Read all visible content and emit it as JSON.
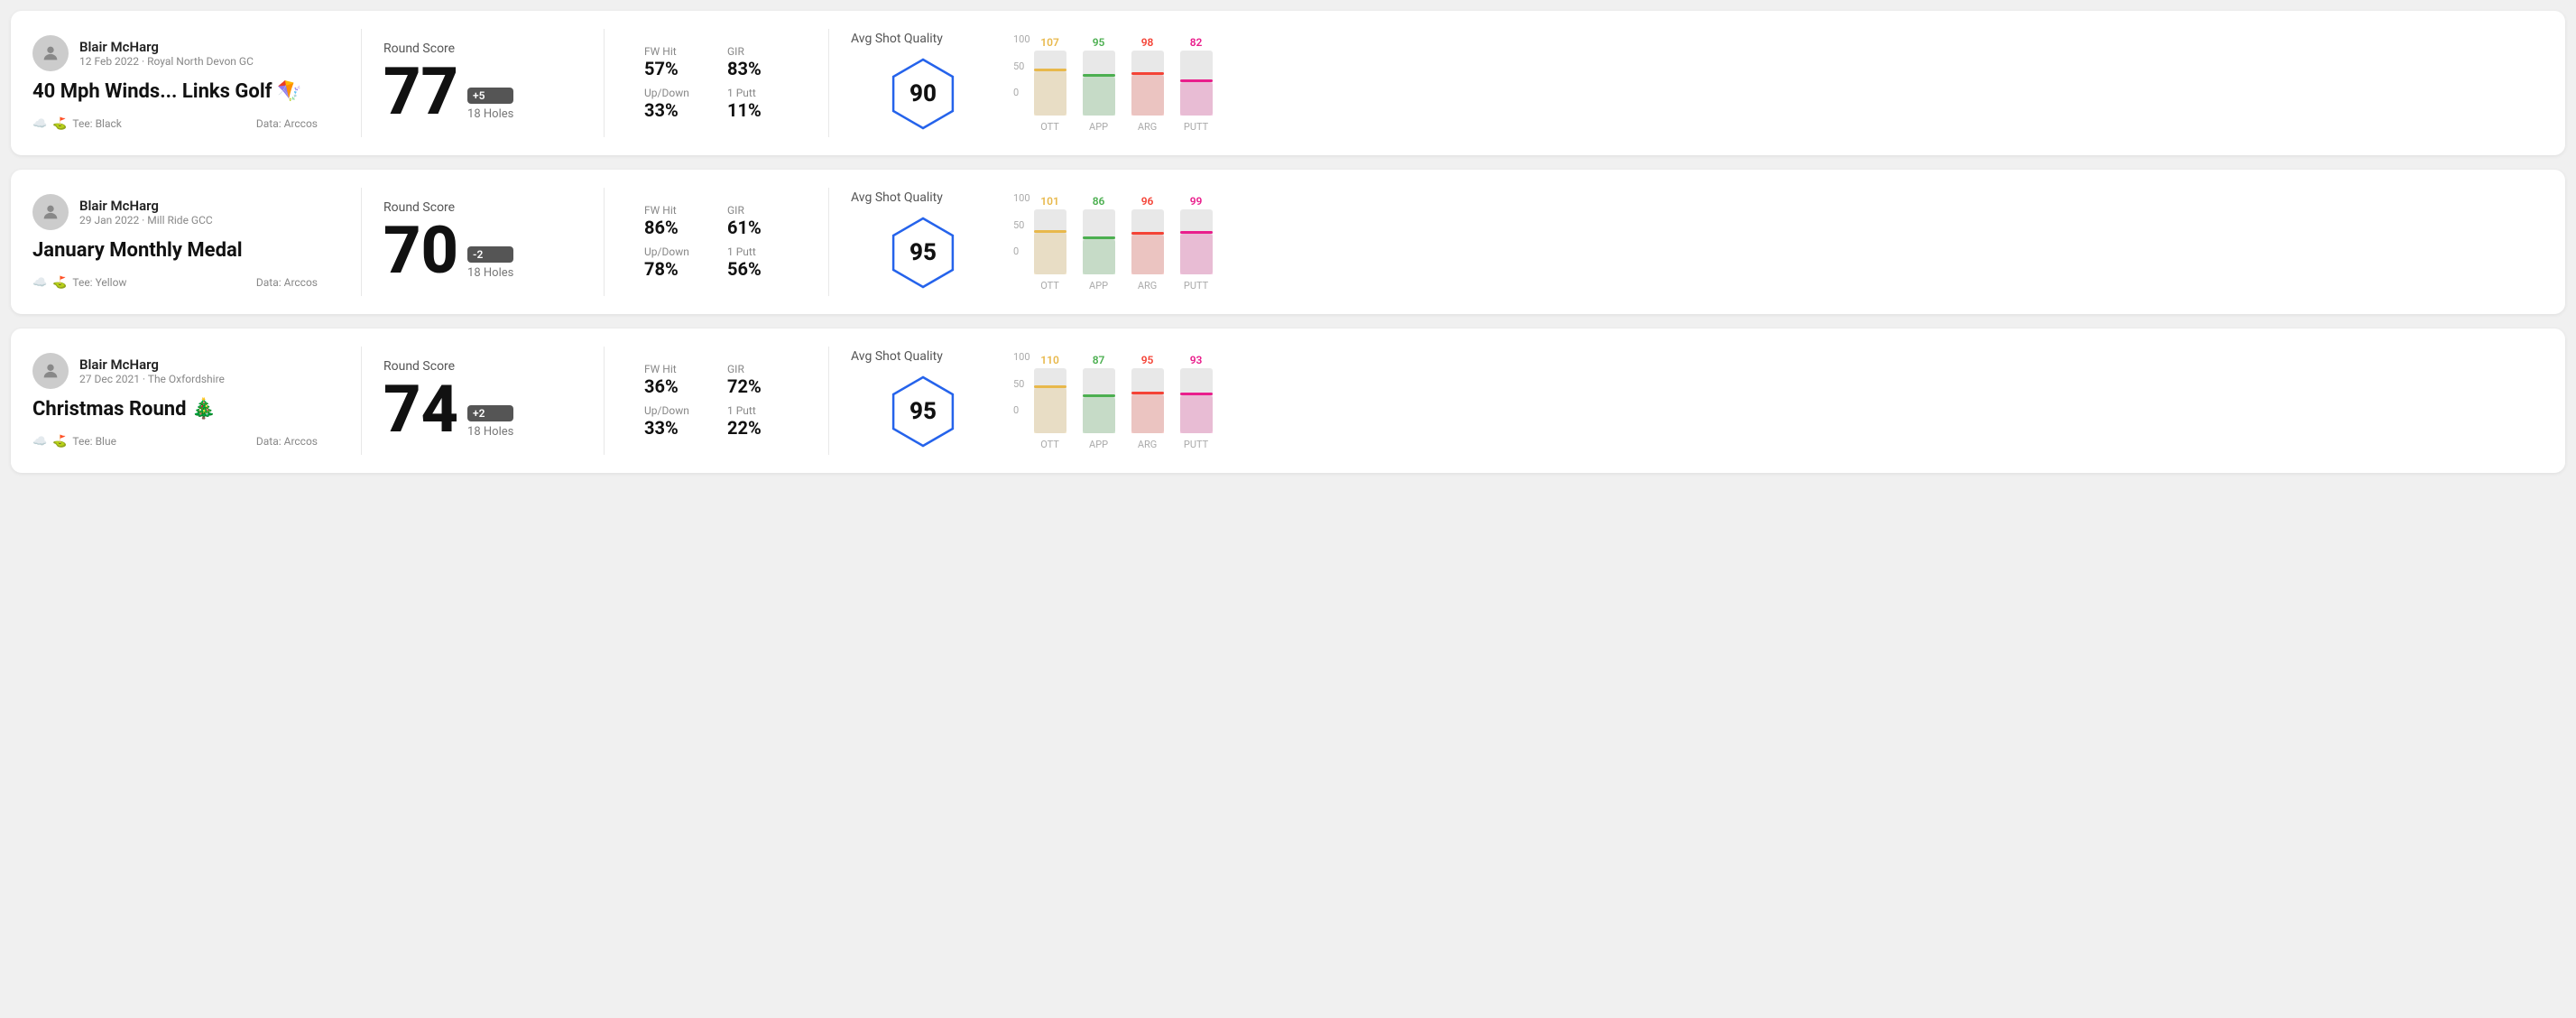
{
  "cards": [
    {
      "id": "card1",
      "user": {
        "name": "Blair McHarg",
        "meta": "12 Feb 2022 · Royal North Devon GC"
      },
      "title": "40 Mph Winds... Links Golf 🪁",
      "tee": "Black",
      "data_source": "Data: Arccos",
      "round_score_label": "Round Score",
      "score": "77",
      "badge": "+5",
      "holes": "18 Holes",
      "stats": [
        {
          "label": "FW Hit",
          "value": "57%"
        },
        {
          "label": "GIR",
          "value": "83%"
        },
        {
          "label": "Up/Down",
          "value": "33%"
        },
        {
          "label": "1 Putt",
          "value": "11%"
        }
      ],
      "quality_label": "Avg Shot Quality",
      "quality_score": "90",
      "chart": [
        {
          "label": "OTT",
          "value": 107,
          "color": "#e8b84b",
          "bar_height_pct": 68
        },
        {
          "label": "APP",
          "value": 95,
          "color": "#4caf50",
          "bar_height_pct": 60
        },
        {
          "label": "ARG",
          "value": 98,
          "color": "#f44336",
          "bar_height_pct": 62
        },
        {
          "label": "PUTT",
          "value": 82,
          "color": "#e91e8c",
          "bar_height_pct": 52
        }
      ]
    },
    {
      "id": "card2",
      "user": {
        "name": "Blair McHarg",
        "meta": "29 Jan 2022 · Mill Ride GCC"
      },
      "title": "January Monthly Medal",
      "tee": "Yellow",
      "data_source": "Data: Arccos",
      "round_score_label": "Round Score",
      "score": "70",
      "badge": "-2",
      "holes": "18 Holes",
      "stats": [
        {
          "label": "FW Hit",
          "value": "86%"
        },
        {
          "label": "GIR",
          "value": "61%"
        },
        {
          "label": "Up/Down",
          "value": "78%"
        },
        {
          "label": "1 Putt",
          "value": "56%"
        }
      ],
      "quality_label": "Avg Shot Quality",
      "quality_score": "95",
      "chart": [
        {
          "label": "OTT",
          "value": 101,
          "color": "#e8b84b",
          "bar_height_pct": 64
        },
        {
          "label": "APP",
          "value": 86,
          "color": "#4caf50",
          "bar_height_pct": 54
        },
        {
          "label": "ARG",
          "value": 96,
          "color": "#f44336",
          "bar_height_pct": 61
        },
        {
          "label": "PUTT",
          "value": 99,
          "color": "#e91e8c",
          "bar_height_pct": 63
        }
      ]
    },
    {
      "id": "card3",
      "user": {
        "name": "Blair McHarg",
        "meta": "27 Dec 2021 · The Oxfordshire"
      },
      "title": "Christmas Round 🎄",
      "tee": "Blue",
      "data_source": "Data: Arccos",
      "round_score_label": "Round Score",
      "score": "74",
      "badge": "+2",
      "holes": "18 Holes",
      "stats": [
        {
          "label": "FW Hit",
          "value": "36%"
        },
        {
          "label": "GIR",
          "value": "72%"
        },
        {
          "label": "Up/Down",
          "value": "33%"
        },
        {
          "label": "1 Putt",
          "value": "22%"
        }
      ],
      "quality_label": "Avg Shot Quality",
      "quality_score": "95",
      "chart": [
        {
          "label": "OTT",
          "value": 110,
          "color": "#e8b84b",
          "bar_height_pct": 70
        },
        {
          "label": "APP",
          "value": 87,
          "color": "#4caf50",
          "bar_height_pct": 55
        },
        {
          "label": "ARG",
          "value": 95,
          "color": "#f44336",
          "bar_height_pct": 60
        },
        {
          "label": "PUTT",
          "value": 93,
          "color": "#e91e8c",
          "bar_height_pct": 59
        }
      ]
    }
  ],
  "y_axis": {
    "top": "100",
    "mid": "50",
    "bot": "0"
  }
}
